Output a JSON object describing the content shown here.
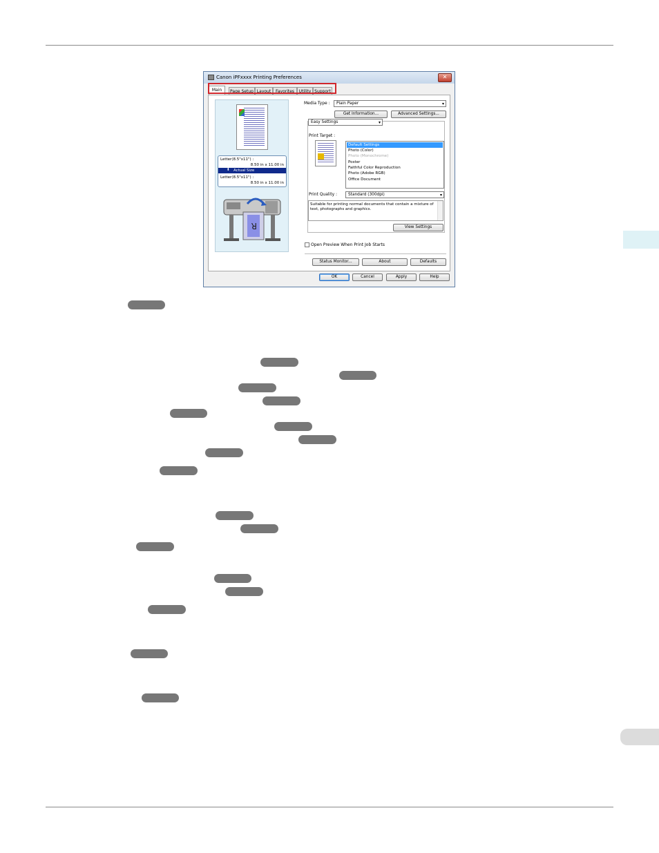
{
  "dialog": {
    "title": "Canon iPFxxxx Printing Preferences",
    "close_glyph": "✕",
    "tabs": [
      "Main",
      "Page Setup",
      "Layout",
      "Favorites",
      "Utility",
      "Support"
    ],
    "preview": {
      "size_line1": "Letter(8.5\"x11\") :",
      "size_line2": "8.50 in x 11.00 in",
      "actual_size": "Actual Size",
      "size_line3": "Letter(8.5\"x11\") :",
      "size_line4": "8.50 in x 11.00 in"
    },
    "media_type_label": "Media Type :",
    "media_type_value": "Plain Paper",
    "get_information_label": "Get Information...",
    "advanced_settings_label": "Advanced Settings...",
    "settings_mode_value": "Easy Settings",
    "print_target_label": "Print Target :",
    "print_targets": [
      "Default Settings",
      "Photo (Color)",
      "Photo (Monochrome)",
      "Poster",
      "Faithful Color Reproduction",
      "Photo (Adobe RGB)",
      "Office Document"
    ],
    "print_quality_label": "Print Quality :",
    "print_quality_value": "Standard (300dpi)",
    "description": "Suitable for printing normal documents that contain a mixture of text, photographs and graphics.",
    "view_settings_label": "View Settings",
    "open_preview_label": "Open Preview When Print Job Starts",
    "status_monitor_label": "Status Monitor...",
    "about_label": "About",
    "defaults_label": "Defaults",
    "ok_label": "OK",
    "cancel_label": "Cancel",
    "apply_label": "Apply",
    "help_label": "Help"
  },
  "colors": {
    "highlight_box": "#d0262c",
    "side_tab": "#dff2f6",
    "link_pill": "#777777",
    "selected_list": "#3399ff"
  }
}
